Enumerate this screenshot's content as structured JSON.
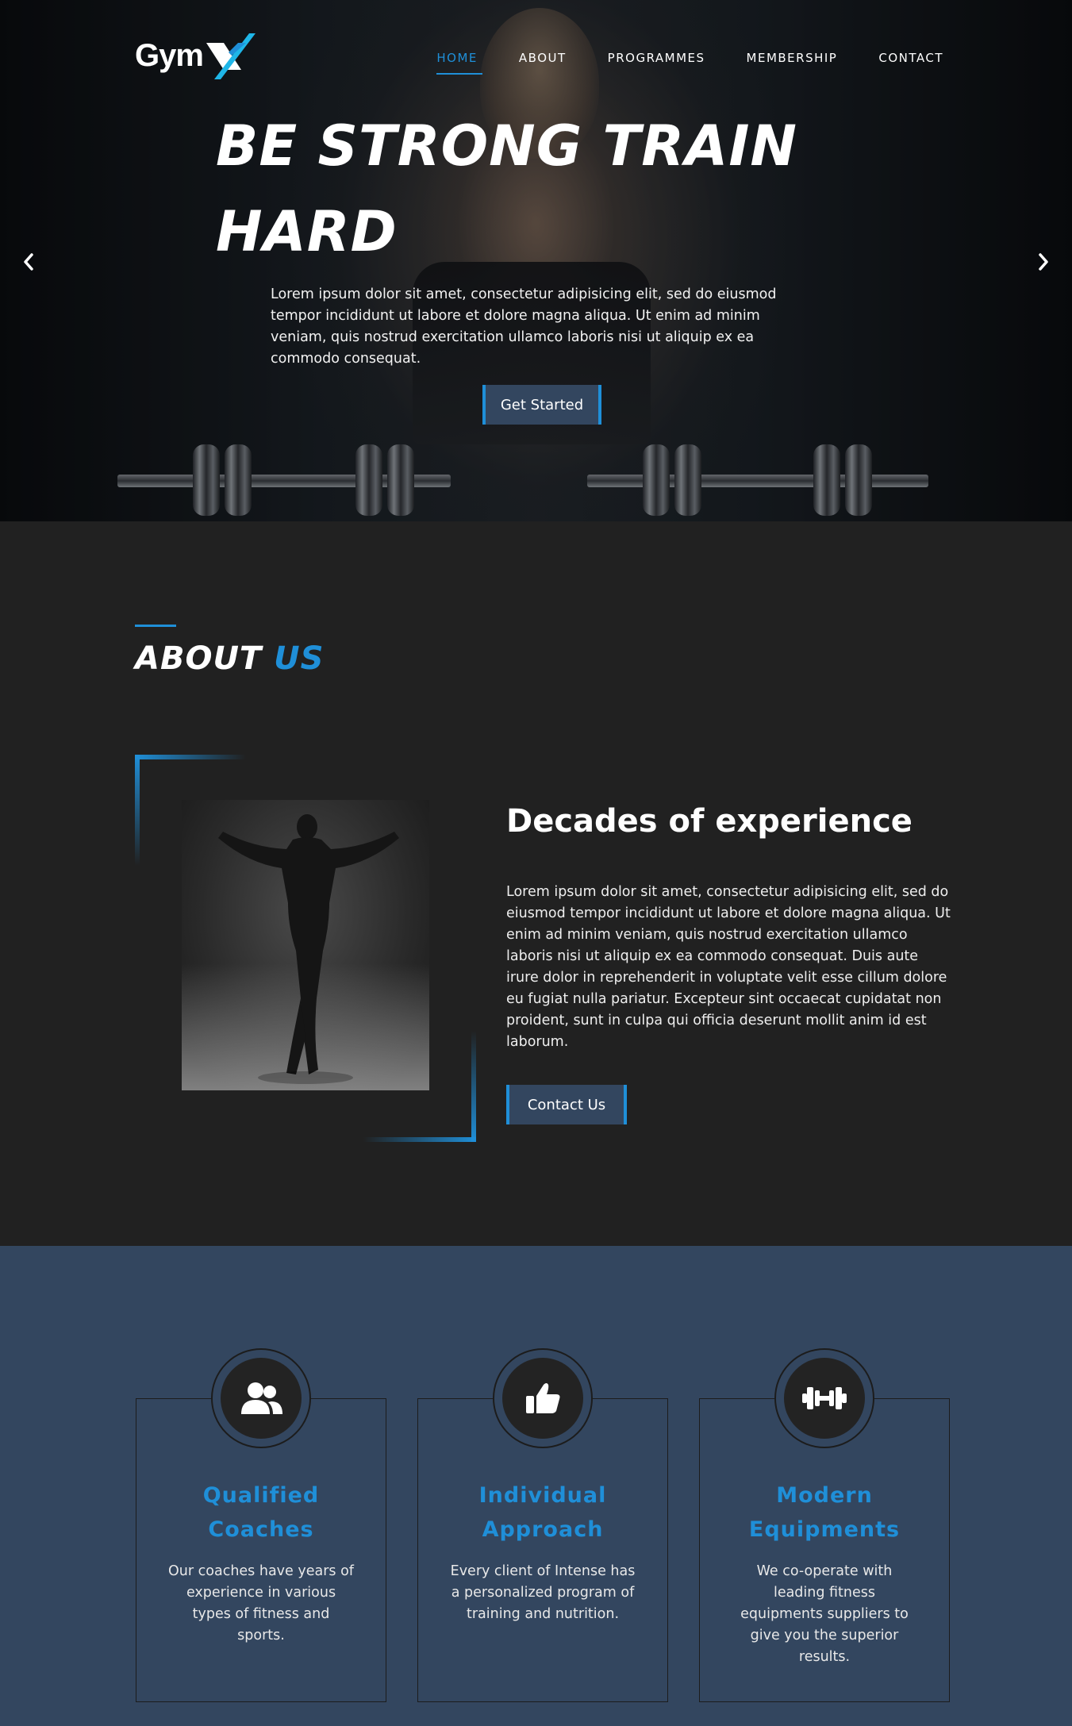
{
  "brand": {
    "logo_text": "Gym",
    "logo_mark": "X",
    "accent": "#1f8fd8",
    "panel": "#33465f"
  },
  "nav": {
    "items": [
      {
        "label": "HOME"
      },
      {
        "label": "ABOUT"
      },
      {
        "label": "PROGRAMMES"
      },
      {
        "label": "MEMBERSHIP"
      },
      {
        "label": "CONTACT"
      }
    ]
  },
  "hero": {
    "title_line1": "BE STRONG TRAIN",
    "title_line2": "HARD",
    "text": "Lorem ipsum dolor sit amet, consectetur adipisicing elit, sed do eiusmod tempor incididunt ut labore et dolore magna aliqua. Ut enim ad minim veniam, quis nostrud exercitation ullamco laboris nisi ut aliquip ex ea commodo consequat.",
    "cta": "Get Started",
    "prev_icon": "chevron-left-icon",
    "next_icon": "chevron-right-icon"
  },
  "about": {
    "heading_main": "ABOUT",
    "heading_accent": "US",
    "title": "Decades of experience",
    "text": "Lorem ipsum dolor sit amet, consectetur adipisicing elit, sed do eiusmod tempor incididunt ut labore et dolore magna aliqua. Ut enim ad minim veniam, quis nostrud exercitation ullamco laboris nisi ut aliquip ex ea commodo consequat. Duis aute irure dolor in reprehenderit in voluptate velit esse cillum dolore eu fugiat nulla pariatur. Excepteur sint occaecat cupidatat non proident, sunt in culpa qui officia deserunt mollit anim id est laborum.",
    "cta": "Contact Us"
  },
  "features": [
    {
      "icon": "users-icon",
      "title": "Qualified Coaches",
      "text": "Our coaches have years of experience in various types of fitness and sports."
    },
    {
      "icon": "thumbs-up-icon",
      "title": "Individual Approach",
      "text": "Every client of Intense has a personalized program of training and nutrition."
    },
    {
      "icon": "dumbbell-icon",
      "title": "Modern Equipments",
      "text": "We co-operate with leading fitness equipments suppliers to give you the superior results."
    }
  ]
}
